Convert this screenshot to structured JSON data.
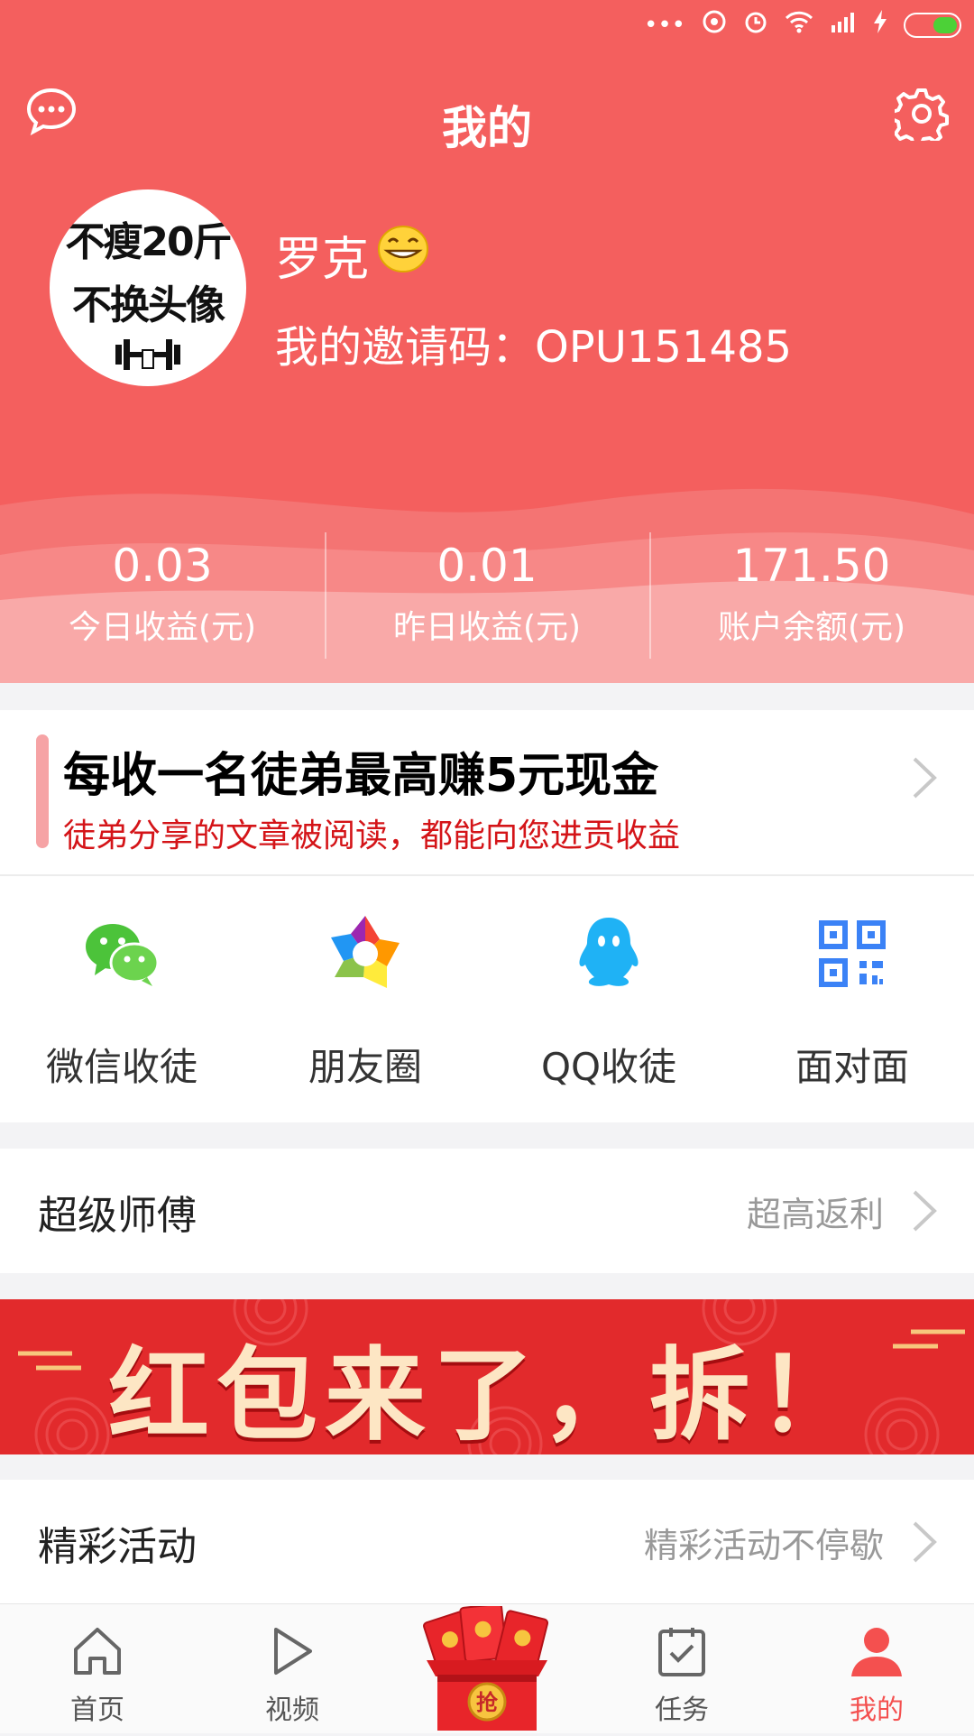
{
  "header": {
    "title": "我的",
    "chat_icon": "chat-bubble-icon",
    "settings_icon": "gear-icon"
  },
  "profile": {
    "avatar_text_line1": "不瘦20斤",
    "avatar_text_line2": "不换头像",
    "username": "罗克",
    "username_emoji": "😁",
    "invite_label": "我的邀请码：OPU151485"
  },
  "stats": [
    {
      "value": "0.03",
      "label": "今日收益(元)"
    },
    {
      "value": "0.01",
      "label": "昨日收益(元)"
    },
    {
      "value": "171.50",
      "label": "账户余额(元)"
    }
  ],
  "invite_card": {
    "title": "每收一名徒弟最高赚5元现金",
    "subtitle": "徒弟分享的文章被阅读，都能向您进贡收益"
  },
  "share": [
    {
      "label": "微信收徒",
      "icon": "wechat-icon"
    },
    {
      "label": "朋友圈",
      "icon": "moments-icon"
    },
    {
      "label": "QQ收徒",
      "icon": "qq-icon"
    },
    {
      "label": "面对面",
      "icon": "qrcode-icon"
    }
  ],
  "rows": {
    "super_master": {
      "title": "超级师傅",
      "sub": "超高返利"
    },
    "activities": {
      "title": "精彩活动",
      "sub": "精彩活动不停歇"
    }
  },
  "banner": {
    "text": "红包来了，拆！"
  },
  "tabbar": [
    {
      "label": "首页",
      "icon": "home-icon"
    },
    {
      "label": "视频",
      "icon": "play-icon"
    },
    {
      "label": "",
      "icon": "red-envelope-icon"
    },
    {
      "label": "任务",
      "icon": "task-icon"
    },
    {
      "label": "我的",
      "icon": "user-icon"
    }
  ],
  "colors": {
    "header_bg": "#f45f5e",
    "accent": "#f4504f",
    "invite_sub": "#d41418",
    "banner_bg": "#e22a2c"
  }
}
